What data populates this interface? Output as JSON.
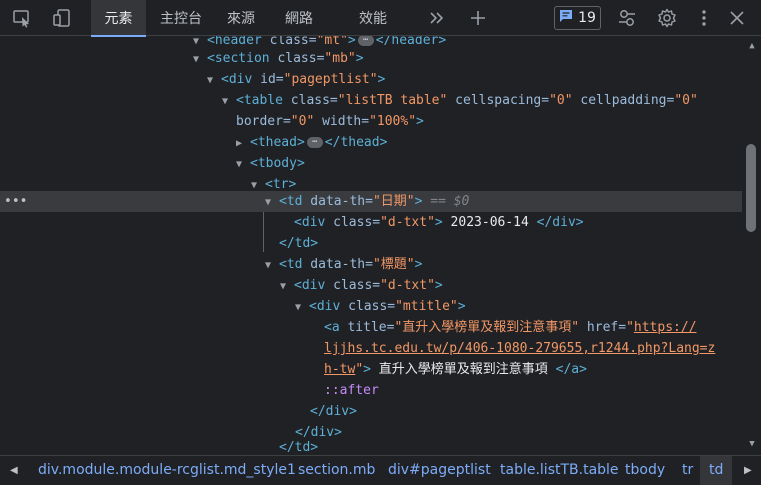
{
  "toolbar": {
    "tabs": [
      {
        "label": "元素"
      },
      {
        "label": "主控台"
      },
      {
        "label": "來源"
      },
      {
        "label": "網路"
      },
      {
        "label": "效能"
      }
    ],
    "more_tabs_icon": "chevrons-right-icon",
    "add_tab_icon": "plus-icon",
    "issues_count": "19",
    "icons": [
      "inspect-element-icon",
      "device-toolbar-icon",
      "message-icon",
      "customize-icon",
      "gear-icon",
      "kebab-menu-icon",
      "close-icon"
    ]
  },
  "tree": {
    "l0": {
      "tag_open": "<header",
      "attr": " class=",
      "val": "\"mt\"",
      "tag_mid": ">",
      "tag_close": "</header>"
    },
    "l1": {
      "tag_open": "<section",
      "attr": " class=",
      "val": "\"mb\"",
      "tag_close": ">"
    },
    "l2": {
      "tag_open": "<div",
      "attr": " id=",
      "val": "\"pageptlist\"",
      "tag_close": ">"
    },
    "l3": {
      "tag_open": "<table",
      "a1": " class=",
      "v1": "\"listTB table\"",
      "a2": " cellspacing=",
      "v2": "\"0\"",
      "a3": " cellpadding=",
      "v3": "\"0\""
    },
    "l4": {
      "a1": "border=",
      "v1": "\"0\"",
      "a2": " width=",
      "v2": "\"100%\"",
      "tag_close": ">"
    },
    "l5": {
      "tag_open": "<thead>",
      "tag_close": "</thead>"
    },
    "l6": {
      "tag": "<tbody>"
    },
    "l7": {
      "tag": "<tr>"
    },
    "l8": {
      "tag_open": "<td",
      "attr": " data-th=",
      "val": "\"日期\"",
      "tag_close": ">",
      "eq": " == $0"
    },
    "l9": {
      "tag_open": "<div",
      "attr": " class=",
      "val": "\"d-txt\"",
      "tag_mid": ">",
      "text": " 2023-06-14 ",
      "tag_close": "</div>"
    },
    "l10": {
      "tag": "</td>"
    },
    "l11": {
      "tag_open": "<td",
      "attr": " data-th=",
      "val": "\"標題\"",
      "tag_close": ">"
    },
    "l12": {
      "tag_open": "<div",
      "attr": " class=",
      "val": "\"d-txt\"",
      "tag_close": ">"
    },
    "l13": {
      "tag_open": "<div",
      "attr": " class=",
      "val": "\"mtitle\"",
      "tag_close": ">"
    },
    "l14": {
      "tag_open": "<a",
      "a1": " title=",
      "v1": "\"直升入學榜單及報到注意事項\"",
      "a2": " href=",
      "v2_q": "\"",
      "v2": "https://"
    },
    "l15": {
      "v": "ljjhs.tc.edu.tw/p/406-1080-279655,r1244.php?Lang=z"
    },
    "l16": {
      "v": "h-tw",
      "v_q": "\"",
      "tag_mid": ">",
      "text": " 直升入學榜單及報到注意事項 ",
      "tag_close": "</a>"
    },
    "l17": {
      "pseudo": "::after"
    },
    "l18": {
      "tag": "</div>"
    },
    "l19": {
      "tag": "</div>"
    },
    "l20": {
      "tag": "</td>"
    }
  },
  "breadcrumbs": [
    {
      "label": "div.module.module-rcglist.md_style1"
    },
    {
      "label": "section.mb"
    },
    {
      "label": "div#pageptlist"
    },
    {
      "label": "table.listTB.table"
    },
    {
      "label": "tbody"
    },
    {
      "label": "tr"
    },
    {
      "label": "td"
    }
  ]
}
